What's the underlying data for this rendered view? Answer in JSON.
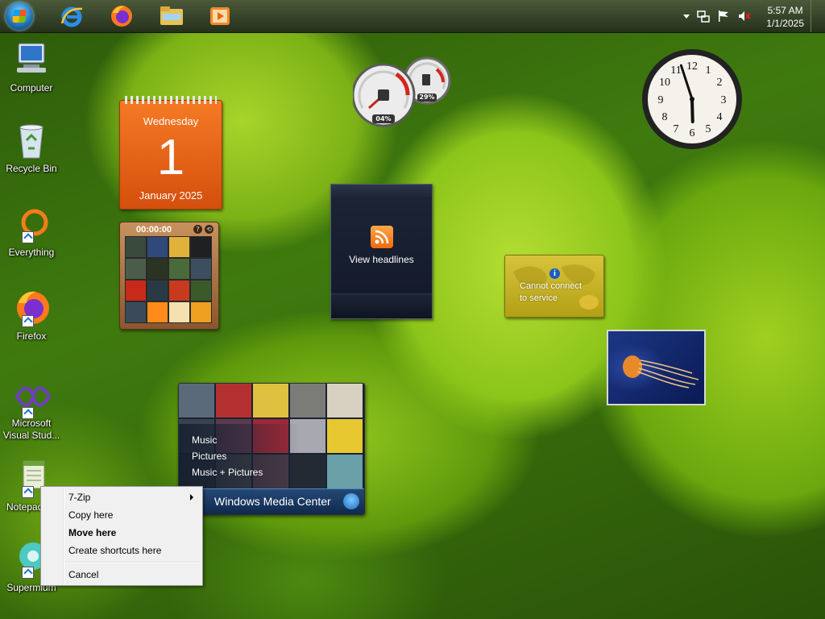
{
  "taskbar": {
    "pinned": [
      {
        "name": "internet-explorer-icon"
      },
      {
        "name": "firefox-icon"
      },
      {
        "name": "file-explorer-icon"
      },
      {
        "name": "media-player-icon"
      }
    ],
    "tray": {
      "time": "5:57 AM",
      "date": "1/1/2025"
    }
  },
  "desktop_icons": [
    {
      "label": "Computer",
      "icon": "computer-icon"
    },
    {
      "label": "Recycle Bin",
      "icon": "recycle-bin-icon"
    },
    {
      "label": "Everything",
      "icon": "everything-icon"
    },
    {
      "label": "Firefox",
      "icon": "firefox-icon"
    },
    {
      "label": "Microsoft Visual Stud...",
      "icon": "visual-studio-icon"
    },
    {
      "label": "Notepad",
      "icon": "notepad-icon"
    },
    {
      "label": "Supermium",
      "icon": "supermium-icon"
    }
  ],
  "gadgets": {
    "calendar": {
      "weekday": "Wednesday",
      "day": "1",
      "month_year": "January 2025"
    },
    "puzzle": {
      "timer": "00:00:00"
    },
    "cpu_meter": {
      "cpu": "04%",
      "memory": "29%"
    },
    "clock": {
      "hour": 5,
      "minute": 57
    },
    "headlines": {
      "label": "View headlines"
    },
    "weather": {
      "message_line1": "Cannot connect",
      "message_line2": "to service"
    },
    "media_center": {
      "items": [
        "Music",
        "Pictures",
        "Music + Pictures"
      ],
      "title": "Windows Media Center"
    }
  },
  "context_menu": {
    "items": [
      {
        "label": "7-Zip",
        "submenu": true
      },
      {
        "label": "Copy here"
      },
      {
        "label": "Move here",
        "default": true
      },
      {
        "label": "Create shortcuts here"
      },
      {
        "label": "Cancel"
      }
    ]
  },
  "colors": {
    "taskbar": "#33402a",
    "calendar": "#e8661a",
    "menu_bg": "#f0f0f0"
  }
}
